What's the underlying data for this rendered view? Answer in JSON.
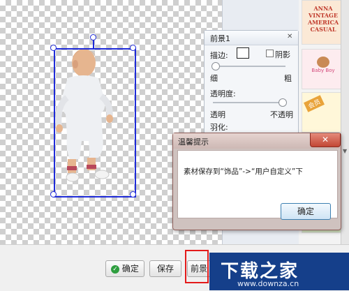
{
  "foreground_panel": {
    "title": "前景1",
    "close_glyph": "✕",
    "stroke_label": "描边:",
    "shadow_label": "阴影",
    "thin_label": "细",
    "thick_label": "粗",
    "opacity_label": "透明度:",
    "transparent_label": "透明",
    "opaque_label": "不透明",
    "feather_label": "羽化:"
  },
  "dialog": {
    "title": "温馨提示",
    "close_glyph": "✕",
    "message": "素材保存到“饰品”->“用户自定义”下",
    "confirm_label": "确定"
  },
  "bottom_bar": {
    "confirm_label": "确定",
    "save_label": "保存",
    "partial_button_label": "前景"
  },
  "thumbnails": {
    "items": [
      {
        "name": "vintage-sticker",
        "text": "ANNA VINTAGE AMERICA CASUAL"
      },
      {
        "name": "bear-sticker",
        "text": "Baby Boy"
      },
      {
        "name": "membership-sticker",
        "text": "会员"
      }
    ]
  },
  "watermark": {
    "text": "下载之家",
    "url": "www.downza.cn"
  },
  "colors": {
    "selection_box": "#1f2bd8",
    "dialog_frame": "#8f5f5a",
    "dialog_close": "#c24735",
    "highlight_frame": "#e41a1a",
    "watermark_bg": "#153f8a"
  }
}
